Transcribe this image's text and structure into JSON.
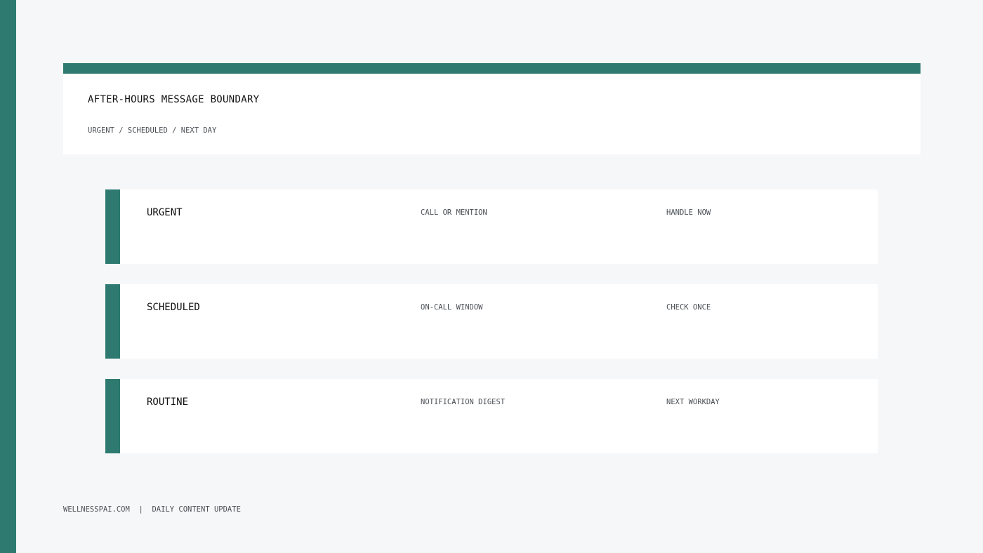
{
  "header": {
    "title": "AFTER-HOURS MESSAGE BOUNDARY",
    "subtitle": "URGENT / SCHEDULED / NEXT DAY"
  },
  "rows": [
    {
      "label": "URGENT",
      "channel": "CALL OR MENTION",
      "action": "HANDLE NOW"
    },
    {
      "label": "SCHEDULED",
      "channel": "ON-CALL WINDOW",
      "action": "CHECK ONCE"
    },
    {
      "label": "ROUTINE",
      "channel": "NOTIFICATION DIGEST",
      "action": "NEXT WORKDAY"
    }
  ],
  "footer": {
    "site": "WELLNESSPAI.COM",
    "separator": "|",
    "tagline": "DAILY CONTENT UPDATE"
  },
  "colors": {
    "accent": "#2e7a70",
    "background": "#f6f7f9",
    "card": "#ffffff",
    "muted_text": "#4a4f55"
  }
}
